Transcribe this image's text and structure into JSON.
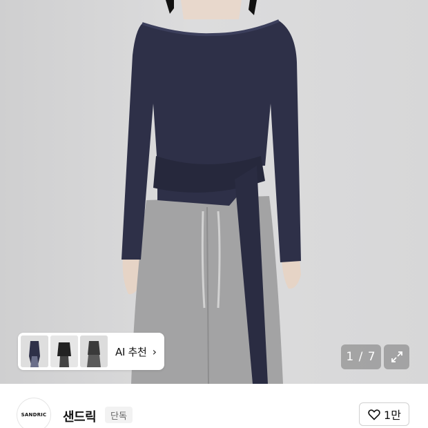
{
  "gallery": {
    "current": "1",
    "total": "7",
    "counter_text": "1 / 7",
    "ai_recommend_label": "AI 추천",
    "thumbnails": [
      "outfit-thumb-1",
      "outfit-thumb-2",
      "outfit-thumb-3"
    ]
  },
  "brand": {
    "logo_text": "SANDRIC",
    "name": "샌드릭",
    "badge": "단독"
  },
  "like": {
    "count": "1만"
  },
  "icons": {
    "expand": "expand-icon",
    "heart": "heart-icon",
    "chevron": "chevron-right-icon"
  }
}
